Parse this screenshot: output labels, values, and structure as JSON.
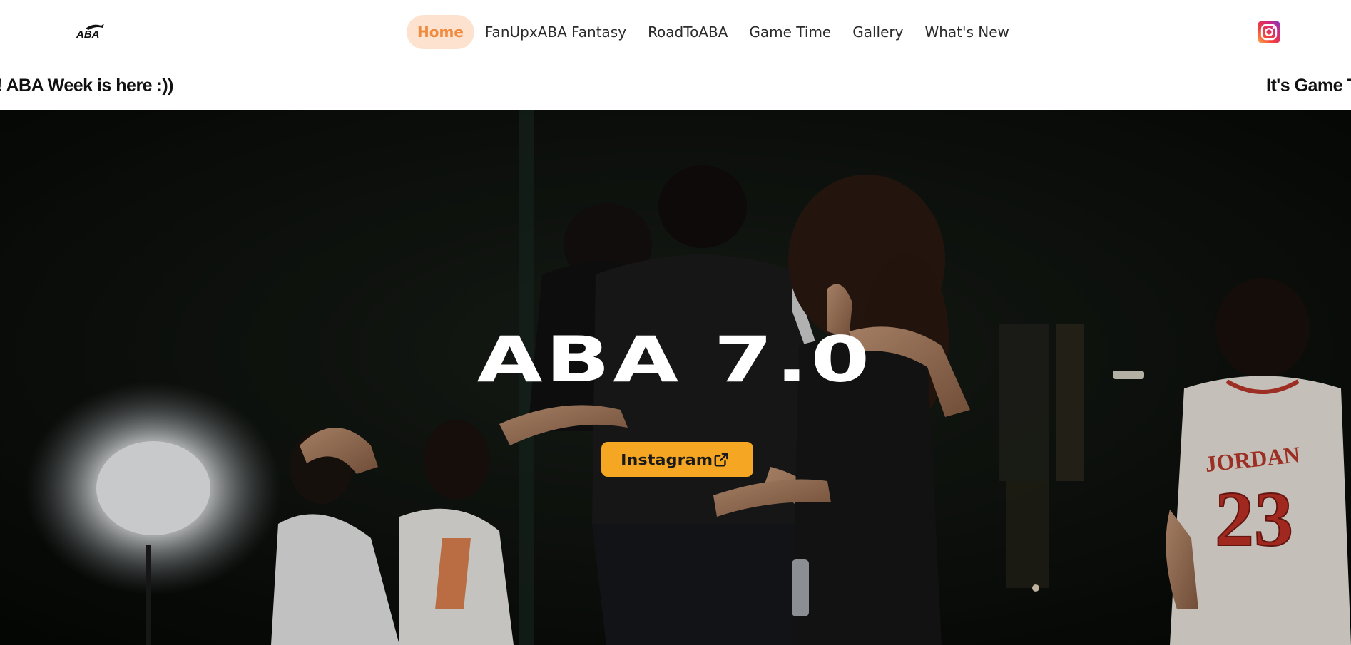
{
  "header": {
    "logo_text": "ABA",
    "nav": [
      {
        "label": "Home",
        "active": true
      },
      {
        "label": "FanUpxABA Fantasy",
        "active": false
      },
      {
        "label": "RoadToABA",
        "active": false
      },
      {
        "label": "Game Time",
        "active": false
      },
      {
        "label": "Gallery",
        "active": false
      },
      {
        "label": "What's New",
        "active": false
      }
    ],
    "social_icon": "instagram-icon"
  },
  "ticker": {
    "left_text": "me! ABA Week is here :))",
    "right_text": "It's Game Ti"
  },
  "hero": {
    "title": "ABA 7.0",
    "button_label": "Instagram",
    "button_icon": "external-link-icon",
    "jersey_text": "JORDAN",
    "jersey_number": "23"
  },
  "colors": {
    "accent": "#f5a623",
    "nav_active_bg": "#fde3cf",
    "nav_active_text": "#f08a3e"
  }
}
